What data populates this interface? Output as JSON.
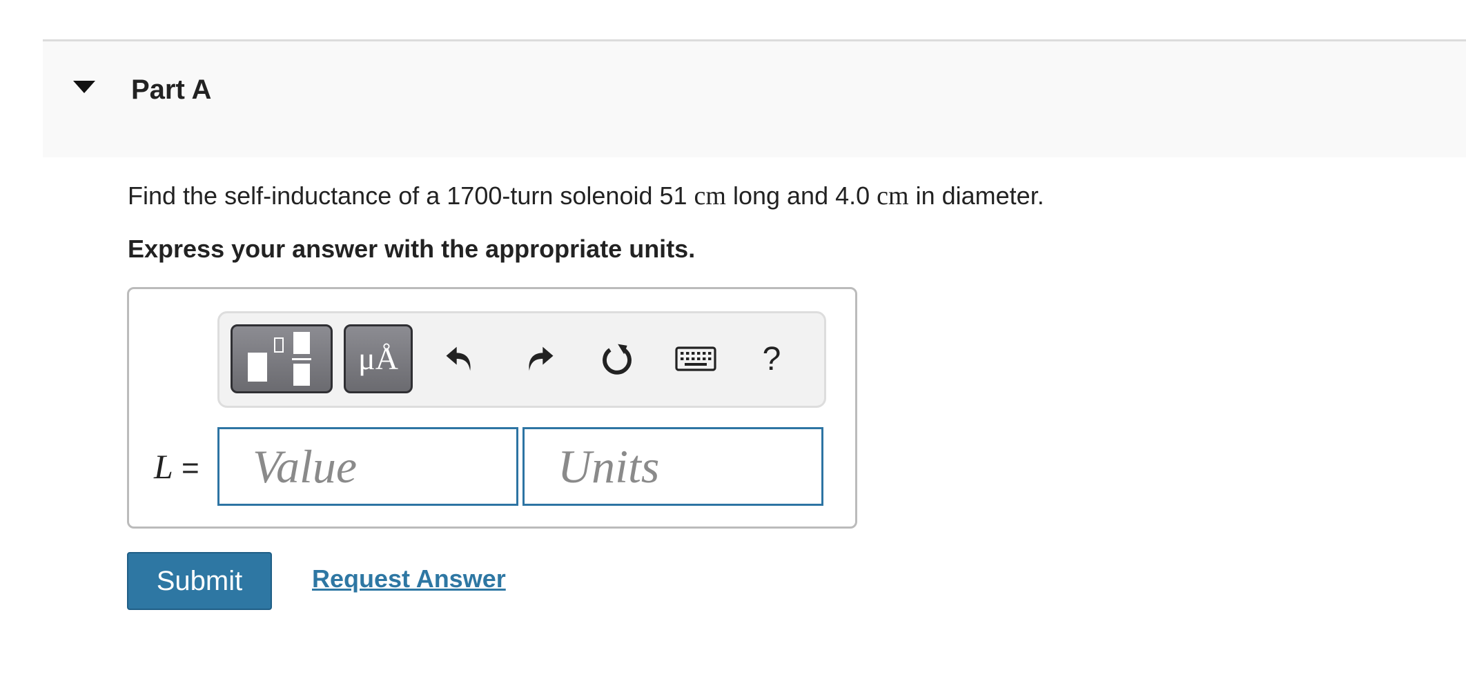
{
  "part": {
    "title": "Part A"
  },
  "question": {
    "segments": {
      "s1": "Find the self-inductance of a 1700-turn solenoid 51 ",
      "u1": "cm",
      "s2": " long and 4.0 ",
      "u2": "cm",
      "s3": " in diameter."
    },
    "instruction": "Express your answer with the appropriate units."
  },
  "toolbar": {
    "symbols_label": "μÅ",
    "help_label": "?",
    "icons": [
      "templates-icon",
      "symbols-icon",
      "undo-icon",
      "redo-icon",
      "reset-icon",
      "keyboard-icon",
      "help-icon"
    ]
  },
  "answer": {
    "variable": "L",
    "equals": " =",
    "value_placeholder": "Value",
    "units_placeholder": "Units"
  },
  "actions": {
    "submit_label": "Submit",
    "request_label": "Request Answer"
  },
  "colors": {
    "accent": "#2e77a3",
    "header_bg": "#f9f9f9",
    "toolbar_bg": "#f2f2f2"
  }
}
